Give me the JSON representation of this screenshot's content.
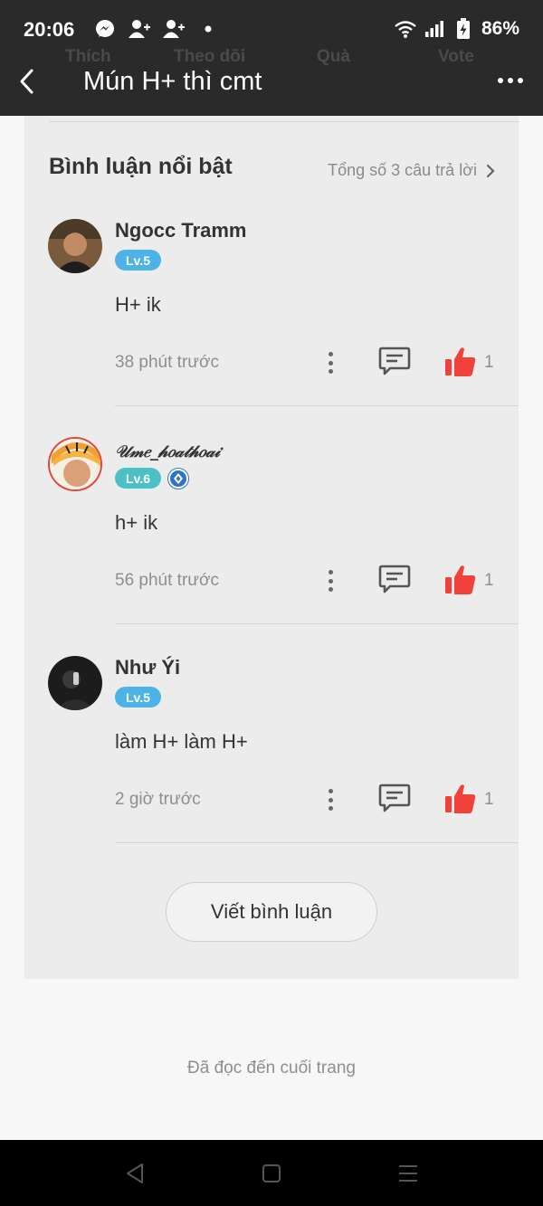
{
  "status_bar": {
    "time": "20:06",
    "battery": "86%"
  },
  "ghost_tabs": [
    "Thích",
    "Theo dõi",
    "Quà",
    "Vote"
  ],
  "header": {
    "title": "Mún H+ thì cmt"
  },
  "section": {
    "title": "Bình luận nổi bật",
    "total": "Tổng số 3 câu trả lời"
  },
  "comments": [
    {
      "user": "Ngocc Tramm",
      "level": "Lv.5",
      "text": "H+ ik",
      "time": "38 phút trước",
      "likes": "1"
    },
    {
      "user": "𝒰𝓂𝑒_𝒽𝑜𝒶𝓉𝒽𝑜𝒶𝒾",
      "level": "Lv.6",
      "text": "h+ ik",
      "time": "56 phút trước",
      "likes": "1"
    },
    {
      "user": "Như Ýi",
      "level": "Lv.5",
      "text": "làm H+ làm H+",
      "time": "2 giờ trước",
      "likes": "1"
    }
  ],
  "write_button": "Viết bình luận",
  "end_text": "Đã đọc đến cuối trang",
  "colors": {
    "header_bg": "#2a2a2a",
    "card_bg": "#ececec",
    "like_red": "#f0413a",
    "lv5": "#4bb3e8",
    "lv6": "#4cc1c5"
  }
}
